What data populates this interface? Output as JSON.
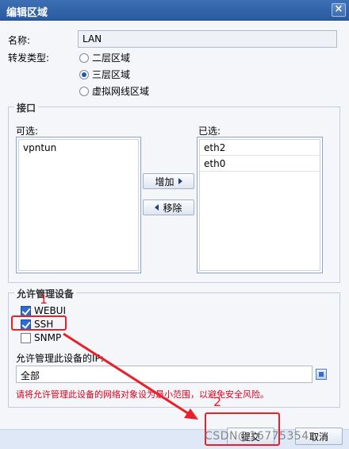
{
  "window": {
    "title": "编辑区域",
    "close": "×"
  },
  "form": {
    "name_label": "名称:",
    "name_value": "LAN",
    "forward_label": "转发类型:",
    "radios": [
      "二层区域",
      "三层区域",
      "虚拟网线区域"
    ],
    "selected_radio": "三层区域"
  },
  "interface": {
    "legend": "接口",
    "available_label": "可选:",
    "selected_label": "已选:",
    "available_items": [
      "vpntun"
    ],
    "selected_items": [
      "eth2",
      "eth0"
    ],
    "add_label": "增加",
    "remove_label": "移除"
  },
  "manage": {
    "legend": "允许管理设备",
    "checks": [
      {
        "label": "WEBUI",
        "checked": true
      },
      {
        "label": "SSH",
        "checked": true
      },
      {
        "label": "SNMP",
        "checked": false
      }
    ],
    "ip_label": "允许管理此设备的IP:",
    "ip_value": "全部",
    "warning": "请将允许管理此设备的网络对象设为最小范围，以避免安全风险。"
  },
  "footer": {
    "submit_label": "提交",
    "cancel_label": "取消"
  },
  "annotations": {
    "marker_1": "1",
    "marker_2": "2"
  },
  "watermark": "CSDN@16775354",
  "colors": {
    "title_bar": "#2a5aa0",
    "annotation_red": "#e8202a",
    "warning_red": "#d9001b"
  }
}
